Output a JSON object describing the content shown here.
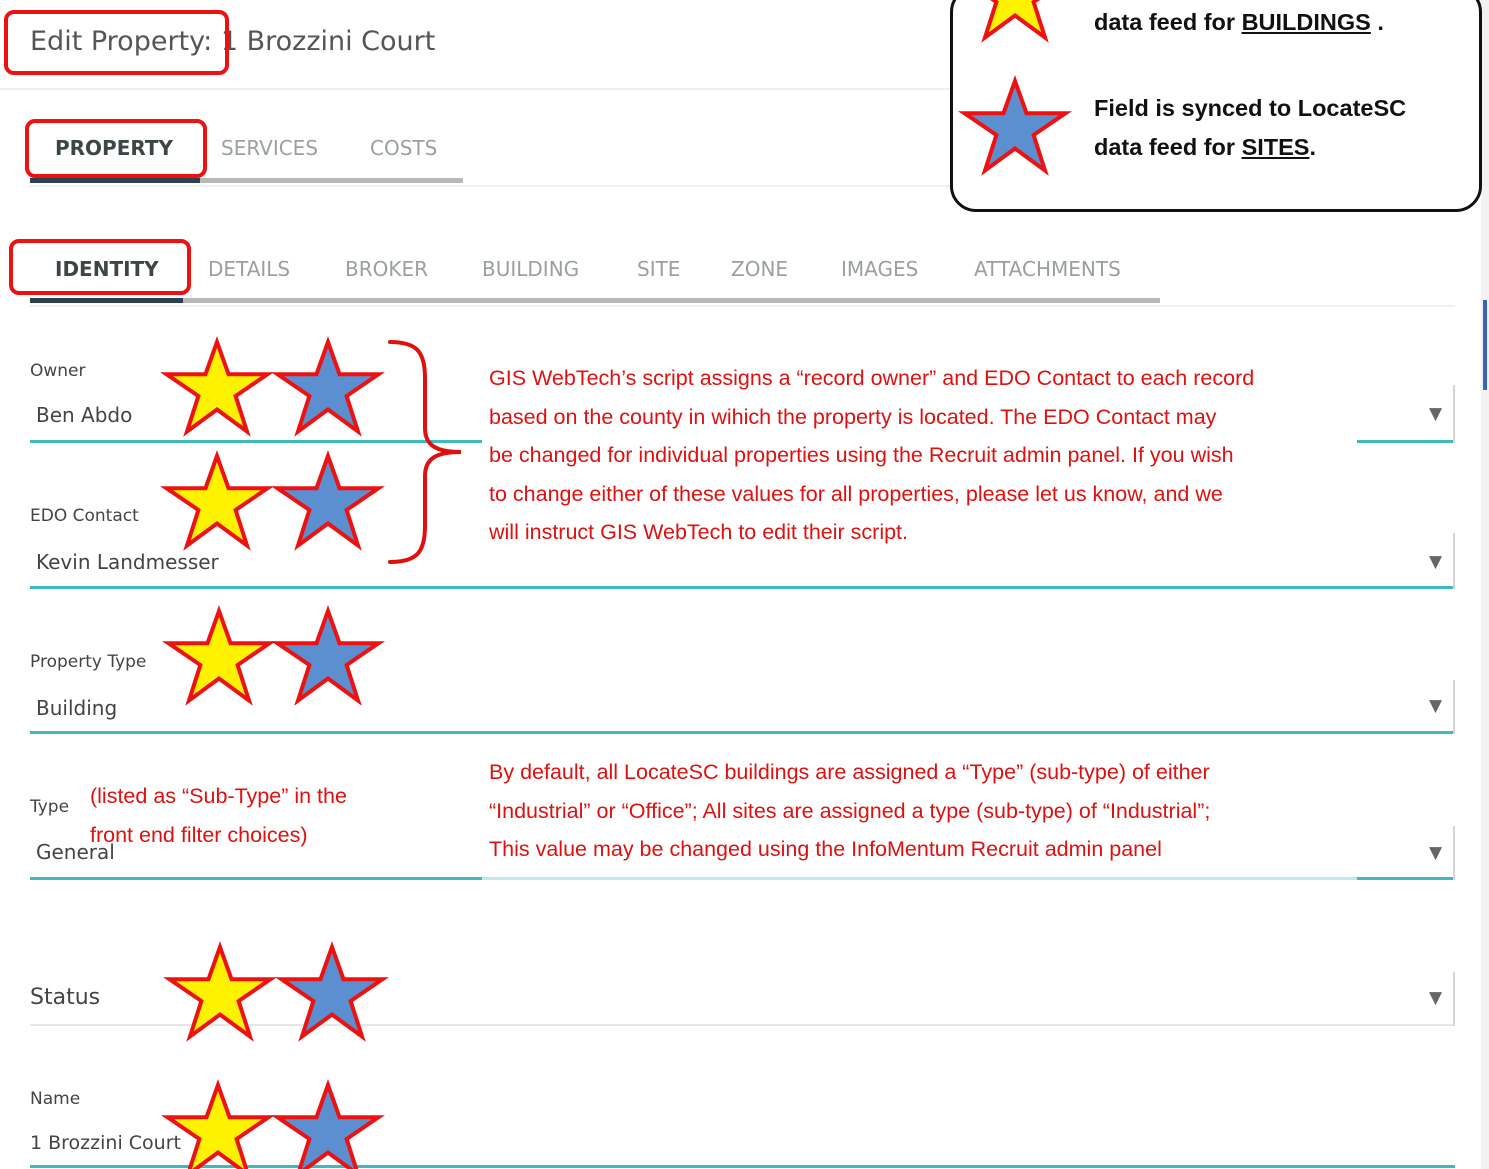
{
  "header": {
    "title": "Edit Property: 1 Brozzini Court"
  },
  "main_tabs": [
    {
      "label": "PROPERTY"
    },
    {
      "label": "SERVICES"
    },
    {
      "label": "COSTS"
    }
  ],
  "sub_tabs": [
    {
      "label": "IDENTITY"
    },
    {
      "label": "DETAILS"
    },
    {
      "label": "BROKER"
    },
    {
      "label": "BUILDING"
    },
    {
      "label": "SITE"
    },
    {
      "label": "ZONE"
    },
    {
      "label": "IMAGES"
    },
    {
      "label": "ATTACHMENTS"
    }
  ],
  "fields": {
    "owner": {
      "label": "Owner",
      "value": "Ben Abdo"
    },
    "edo_contact": {
      "label": "EDO Contact",
      "value": "Kevin Landmesser"
    },
    "property_type": {
      "label": "Property Type",
      "value": "Building"
    },
    "type": {
      "label": "Type",
      "value": "General"
    },
    "status": {
      "label": "Status"
    },
    "name": {
      "label": "Name",
      "value": "1 Brozzini Court"
    }
  },
  "dropdown_arrow": "▼",
  "legend": {
    "line1_prefix": "data feed for ",
    "line1_emph": "BUILDINGS",
    "line1_suffix": " .",
    "line2": "Field is synced to LocateSC",
    "line3_prefix": "data feed for ",
    "line3_emph": "SITES",
    "line3_suffix": "."
  },
  "annotations": {
    "owner_lines": [
      "GIS WebTech’s script assigns a “record owner” and EDO Contact to each record",
      "based on the county in wihich the property is located.  The EDO Contact may",
      "be changed for individual properties using the Recruit admin panel.  If you wish",
      "to change either of these values for all properties, please let us know, and we",
      "will instruct GIS WebTech to edit their script."
    ],
    "subtype_note": [
      "(listed as “Sub-Type” in the",
      "front end filter choices)"
    ],
    "type_lines": [
      "By default, all LocateSC buildings are assigned a “Type” (sub-type) of either",
      "“Industrial” or “Office”;  All sites are assigned a type (sub-type) of “Industrial”;",
      "This value may be changed using the InfoMentum Recruit admin panel"
    ]
  },
  "colors": {
    "building_star": "#fff200",
    "site_star": "#5b8fd0",
    "star_outline": "#ee1111",
    "annotation": "#e01010",
    "underline": "#3fb9bf"
  }
}
